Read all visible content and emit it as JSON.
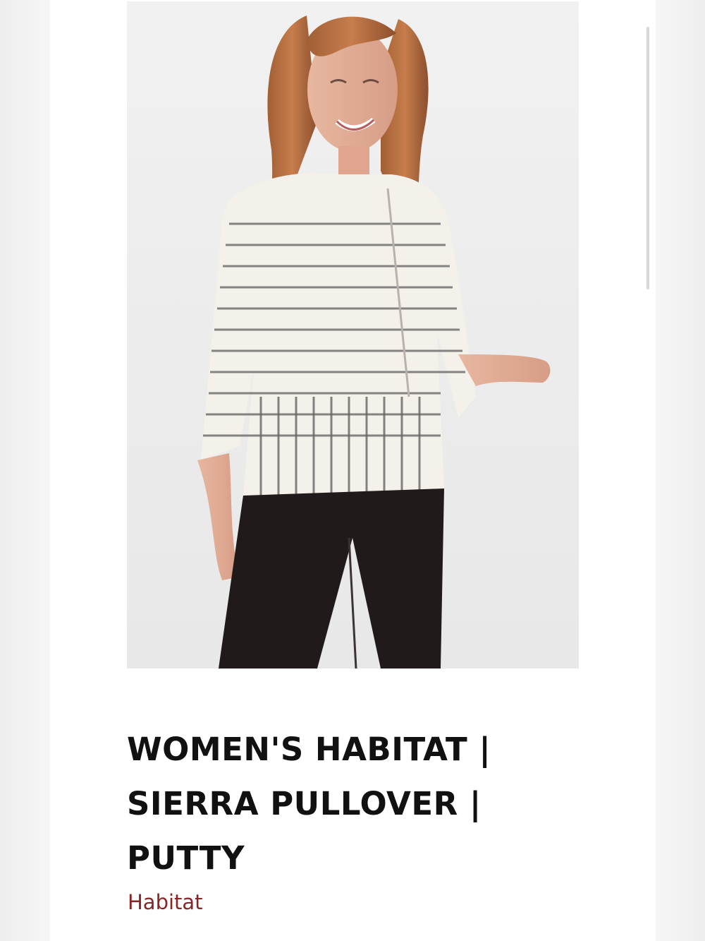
{
  "product": {
    "title_lines": [
      "WOMEN'S HABITAT |",
      "SIERRA PULLOVER |",
      "PUTTY"
    ],
    "brand": "Habitat",
    "image_icon": "product-photo-icon"
  },
  "colors": {
    "brand_link": "#8a2525",
    "title": "#111111",
    "background": "#ffffff"
  }
}
